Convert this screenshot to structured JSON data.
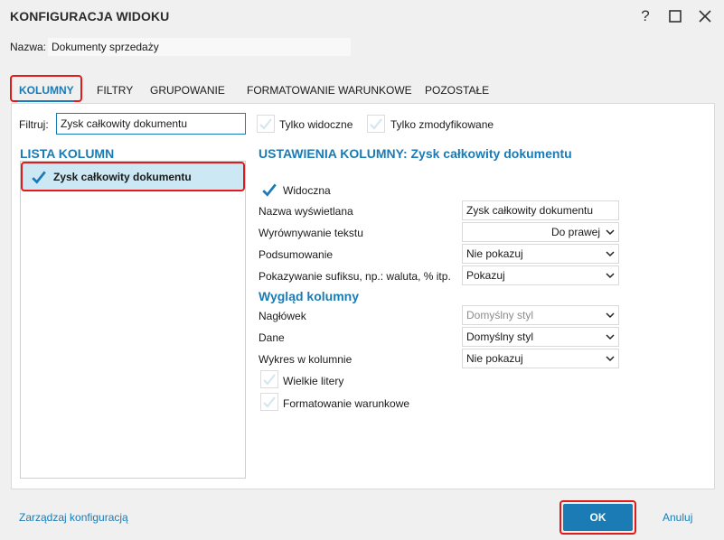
{
  "window": {
    "title": "KONFIGURACJA WIDOKU",
    "help_symbol": "?",
    "maximize_symbol": "☐",
    "close_symbol": "✕"
  },
  "name_row": {
    "label": "Nazwa:",
    "value": "Dokumenty sprzedaży"
  },
  "tabs": [
    {
      "label": "KOLUMNY",
      "active": true
    },
    {
      "label": "FILTRY",
      "active": false
    },
    {
      "label": "GRUPOWANIE",
      "active": false
    },
    {
      "label": "FORMATOWANIE WARUNKOWE",
      "active": false
    },
    {
      "label": "POZOSTAŁE",
      "active": false
    }
  ],
  "filter": {
    "label": "Filtruj:",
    "value": "Zysk całkowity dokumentu",
    "only_visible_label": "Tylko widoczne",
    "only_visible_checked": false,
    "only_modified_label": "Tylko zmodyfikowane",
    "only_modified_checked": false
  },
  "column_list": {
    "title": "LISTA KOLUMN",
    "items": [
      {
        "label": "Zysk całkowity dokumentu",
        "checked": true,
        "selected": true
      }
    ]
  },
  "settings": {
    "title": "USTAWIENIA KOLUMNY: Zysk całkowity dokumentu",
    "visible_label": "Widoczna",
    "visible_checked": true,
    "display_name_label": "Nazwa wyświetlana",
    "display_name_value": "Zysk całkowity dokumentu",
    "alignment_label": "Wyrównywanie tekstu",
    "alignment_value": "Do prawej",
    "summary_label": "Podsumowanie",
    "summary_value": "Nie pokazuj",
    "suffix_label": "Pokazywanie sufiksu, np.: waluta, % itp.",
    "suffix_value": "Pokazuj"
  },
  "appearance": {
    "title": "Wygląd kolumny",
    "header_label": "Nagłówek",
    "header_value": "Domyślny styl",
    "data_label": "Dane",
    "data_value": "Domyślny styl",
    "chart_label": "Wykres w kolumnie",
    "chart_value": "Nie pokazuj",
    "uppercase_label": "Wielkie litery",
    "uppercase_checked": false,
    "conditional_label": "Formatowanie warunkowe",
    "conditional_checked": false
  },
  "footer": {
    "manage_label": "Zarządzaj konfiguracją",
    "ok_label": "OK",
    "cancel_label": "Anuluj"
  },
  "colors": {
    "accent": "#1a7bb5",
    "highlight_border": "#e01b1b",
    "selection_bg": "#cde8f5"
  },
  "icons": {
    "checkmark": "check-icon",
    "dropdown": "chevron-down-icon"
  }
}
